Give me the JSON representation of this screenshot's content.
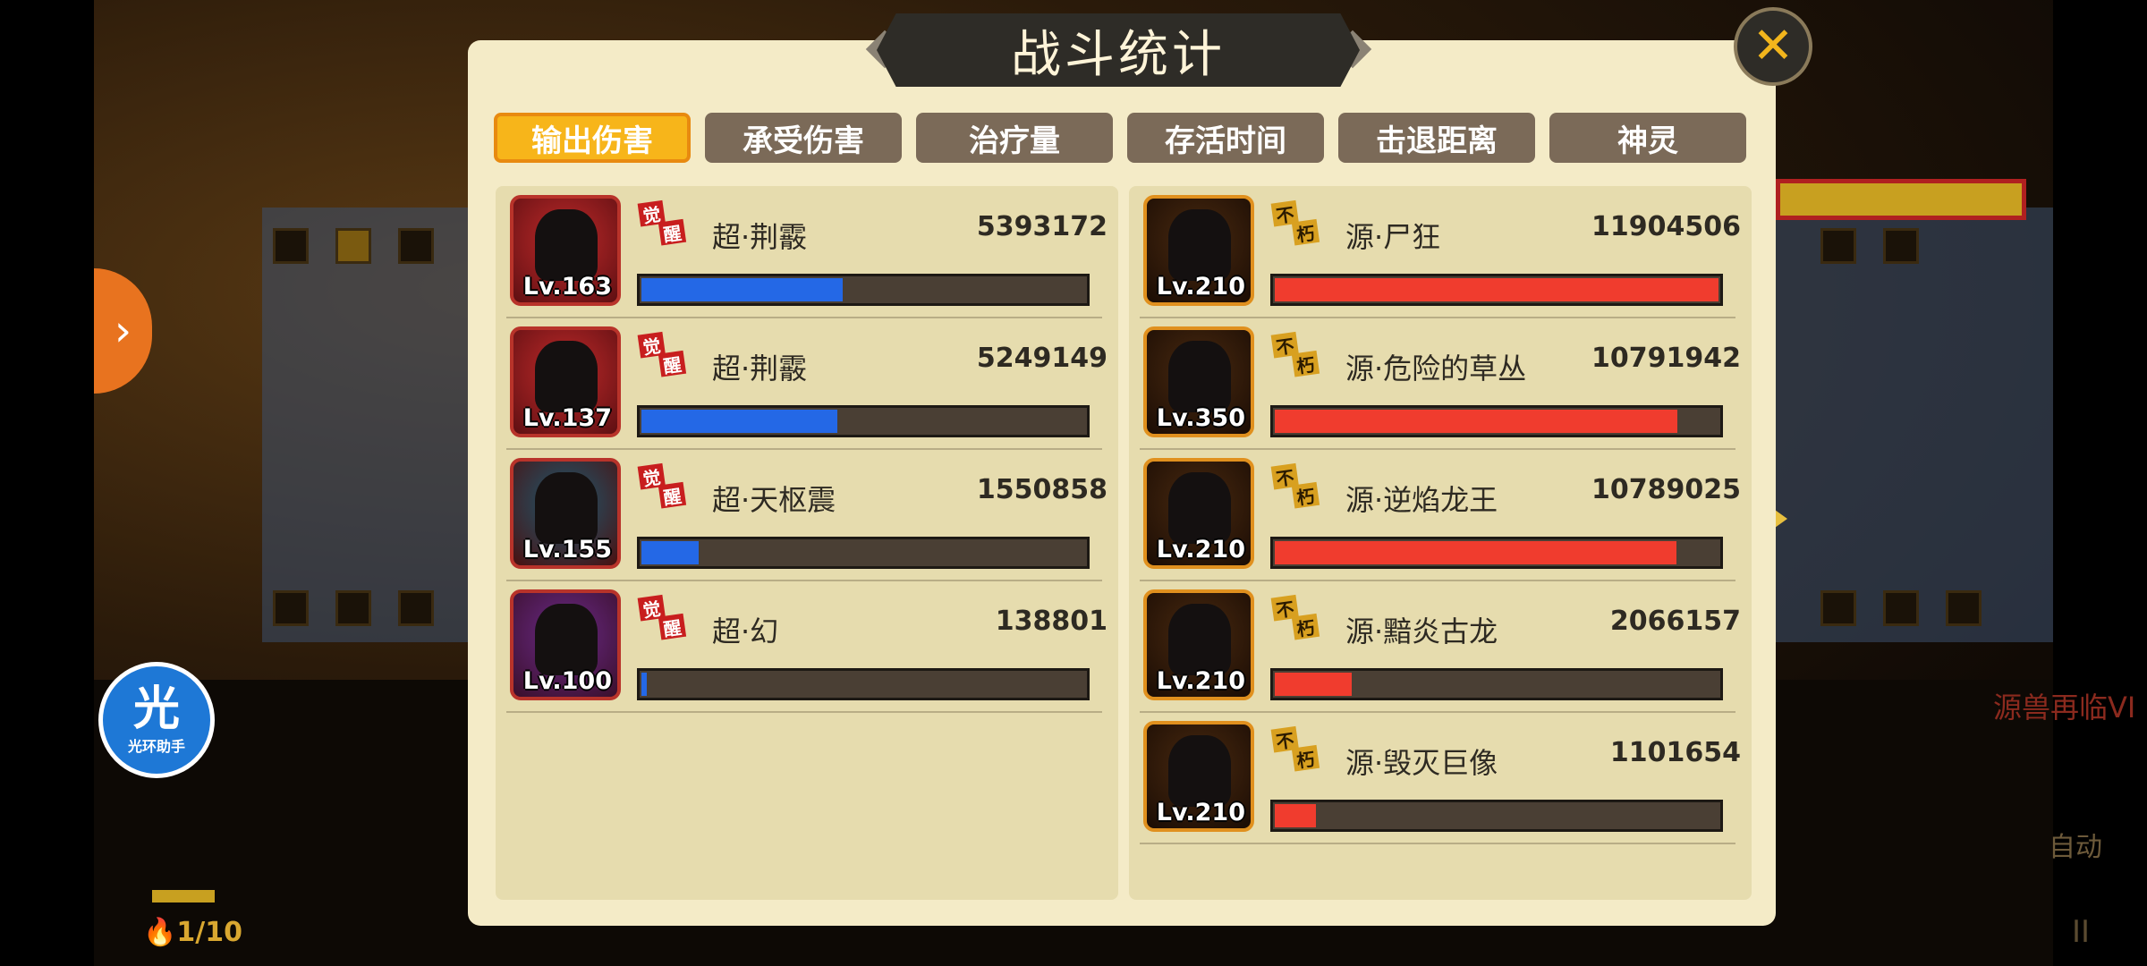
{
  "dialog": {
    "title": "战斗统计",
    "close_label": "✕",
    "tabs": [
      {
        "label": "输出伤害",
        "active": true
      },
      {
        "label": "承受伤害",
        "active": false
      },
      {
        "label": "治疗量",
        "active": false
      },
      {
        "label": "存活时间",
        "active": false
      },
      {
        "label": "击退距离",
        "active": false
      },
      {
        "label": "神灵",
        "active": false
      }
    ]
  },
  "left_team": {
    "bar_color": "#2468e6",
    "badge": {
      "top": "觉",
      "bottom": "醒"
    },
    "units": [
      {
        "level": "Lv.163",
        "name": "超·荆霰",
        "value": "5393172",
        "fraction": 0.453
      },
      {
        "level": "Lv.137",
        "name": "超·荆霰",
        "value": "5249149",
        "fraction": 0.441
      },
      {
        "level": "Lv.155",
        "name": "超·天枢震",
        "value": "1550858",
        "fraction": 0.13
      },
      {
        "level": "Lv.100",
        "name": "超·幻",
        "value": "138801",
        "fraction": 0.012
      }
    ]
  },
  "right_team": {
    "bar_color": "#f03c2e",
    "badge": {
      "top": "不",
      "bottom": "朽"
    },
    "units": [
      {
        "level": "Lv.210",
        "name": "源·尸狂",
        "value": "11904506",
        "fraction": 1.0
      },
      {
        "level": "Lv.350",
        "name": "源·危险的草丛",
        "value": "10791942",
        "fraction": 0.907
      },
      {
        "level": "Lv.210",
        "name": "源·逆焰龙王",
        "value": "10789025",
        "fraction": 0.906
      },
      {
        "level": "Lv.210",
        "name": "源·黯炎古龙",
        "value": "2066157",
        "fraction": 0.174
      },
      {
        "level": "Lv.210",
        "name": "源·毁灭巨像",
        "value": "1101654",
        "fraction": 0.093
      }
    ]
  },
  "overlay": {
    "helper_big": "光",
    "helper_small": "光环助手",
    "energy": "1/10",
    "stage_name": "源兽再临VI",
    "auto_label": "自动",
    "pause_label": "II"
  },
  "icons": {
    "nav_left": "chevron-right-icon",
    "close": "close-icon"
  }
}
